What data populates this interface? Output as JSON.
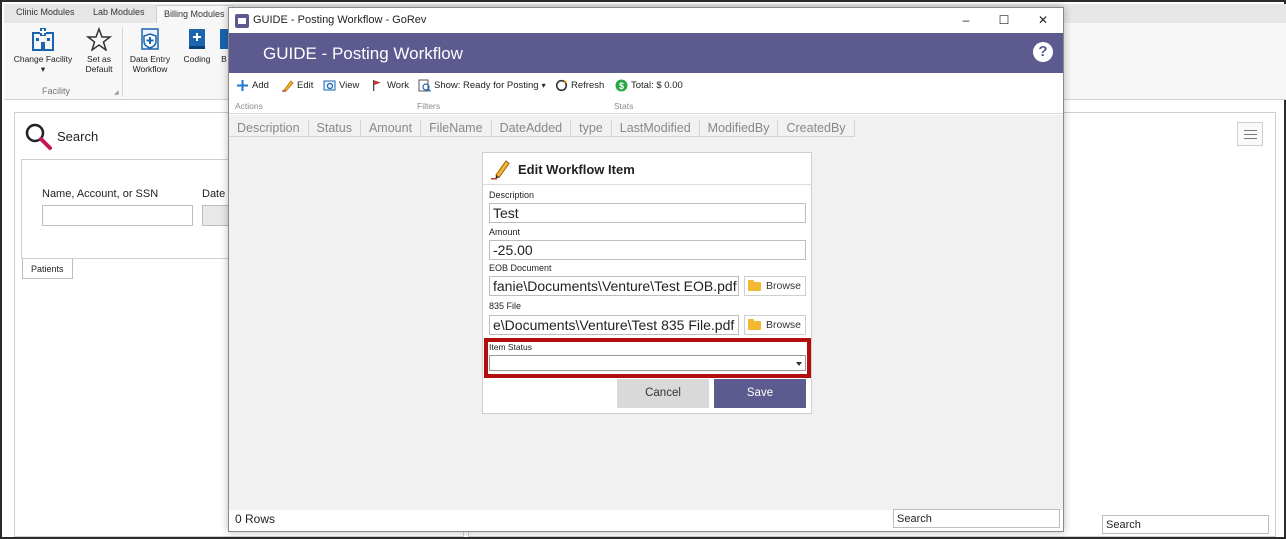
{
  "background_app": {
    "tabs": [
      "Clinic Modules",
      "Lab Modules",
      "Billing Modules"
    ],
    "ribbon": {
      "buttons": [
        {
          "label": "Change Facility",
          "icon": "hospital-icon"
        },
        {
          "label": "Set as Default",
          "icon": "star-icon"
        },
        {
          "label": "Data Entry Workflow",
          "icon": "shield-doc-icon"
        },
        {
          "label": "Coding",
          "icon": "book-plus-icon"
        },
        {
          "label": "B",
          "icon": "document-icon"
        }
      ],
      "groups": [
        "Facility"
      ]
    },
    "search_panel": {
      "title": "Search",
      "name_label": "Name, Account, or SSN",
      "date_label": "Date o",
      "tab": "Patients"
    },
    "search_placeholder": "Search"
  },
  "window": {
    "title": "GUIDE - Posting Workflow - GoRev",
    "controls": [
      "–",
      "☐",
      "✕"
    ],
    "header_title": "GUIDE - Posting Workflow",
    "help_icon": "?",
    "toolbar": {
      "add": "Add",
      "edit": "Edit",
      "view": "View",
      "work": "Work",
      "show": "Show: Ready for Posting",
      "refresh": "Refresh",
      "total": "Total: $ 0.00"
    },
    "toolbar_groups": {
      "actions": "Actions",
      "filters": "Filters",
      "stats": "Stats"
    },
    "columns": [
      "Description",
      "Status",
      "Amount",
      "FileName",
      "DateAdded",
      "type",
      "LastModified",
      "ModifiedBy",
      "CreatedBy"
    ],
    "rows_label": "0 Rows",
    "search_placeholder": "Search"
  },
  "dialog": {
    "title": "Edit Workflow Item",
    "description_label": "Description",
    "description_value": "Test",
    "amount_label": "Amount",
    "amount_value": "-25.00",
    "eob_label": "EOB Document",
    "eob_value": "fanie\\Documents\\Venture\\Test EOB.pdf",
    "file835_label": "835 File",
    "file835_value": "e\\Documents\\Venture\\Test 835 File.pdf",
    "browse_label": "Browse",
    "status_label": "Item Status",
    "status_value": "",
    "cancel_label": "Cancel",
    "save_label": "Save"
  },
  "colors": {
    "header_purple": "#5c5a8f",
    "highlight_red": "#b30d0d",
    "button_gray": "#d9d9d9"
  }
}
